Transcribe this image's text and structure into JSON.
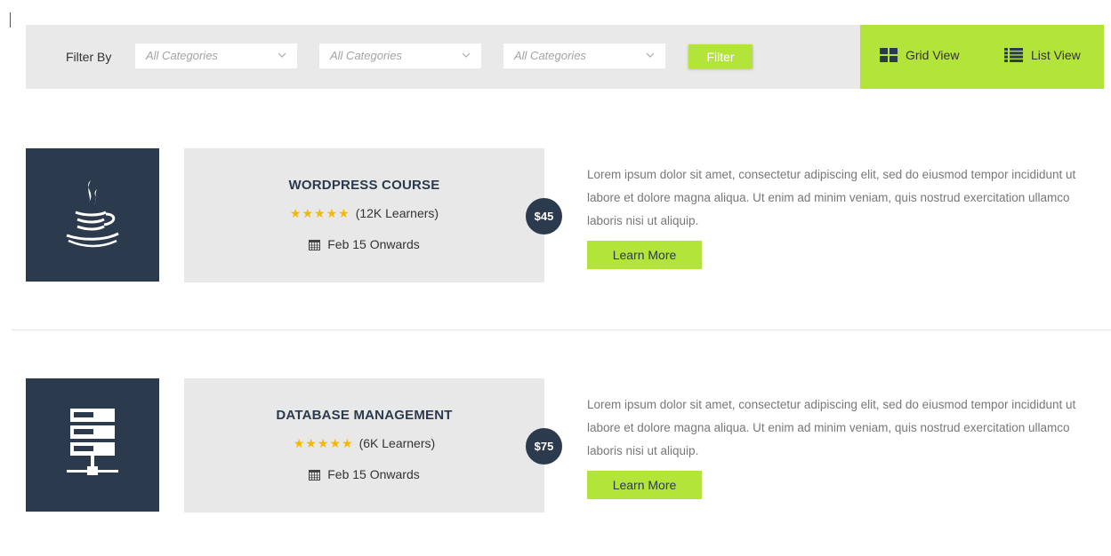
{
  "filter_bar": {
    "label": "Filter By",
    "selects": [
      {
        "value": "All Categories"
      },
      {
        "value": "All Categories"
      },
      {
        "value": "All Categories"
      }
    ],
    "filter_button": "Filter",
    "views": {
      "grid": "Grid View",
      "list": "List View"
    }
  },
  "courses": [
    {
      "icon": "java-cup-icon",
      "title": "WORDPRESS COURSE",
      "stars": "★★★★★",
      "learners": "(12K Learners)",
      "date": "Feb 15 Onwards",
      "price": "$45",
      "description": "Lorem ipsum dolor sit amet, consectetur adipiscing elit, sed do eiusmod tempor incididunt ut labore et dolore magna aliqua. Ut enim ad minim veniam, quis nostrud exercitation ullamco laboris nisi ut aliquip.",
      "button": "Learn More"
    },
    {
      "icon": "database-server-icon",
      "title": "DATABASE MANAGEMENT",
      "stars": "★★★★★",
      "learners": "(6K Learners)",
      "date": "Feb 15 Onwards",
      "price": "$75",
      "description": "Lorem ipsum dolor sit amet, consectetur adipiscing elit, sed do eiusmod tempor incididunt ut labore et dolore magna aliqua. Ut enim ad minim veniam, quis nostrud exercitation ullamco laboris nisi ut aliquip.",
      "button": "Learn More"
    }
  ],
  "colors": {
    "accent": "#b3e43a",
    "navy": "#2c3a4d",
    "panel": "#e8e8e8",
    "star": "#f5b800"
  }
}
